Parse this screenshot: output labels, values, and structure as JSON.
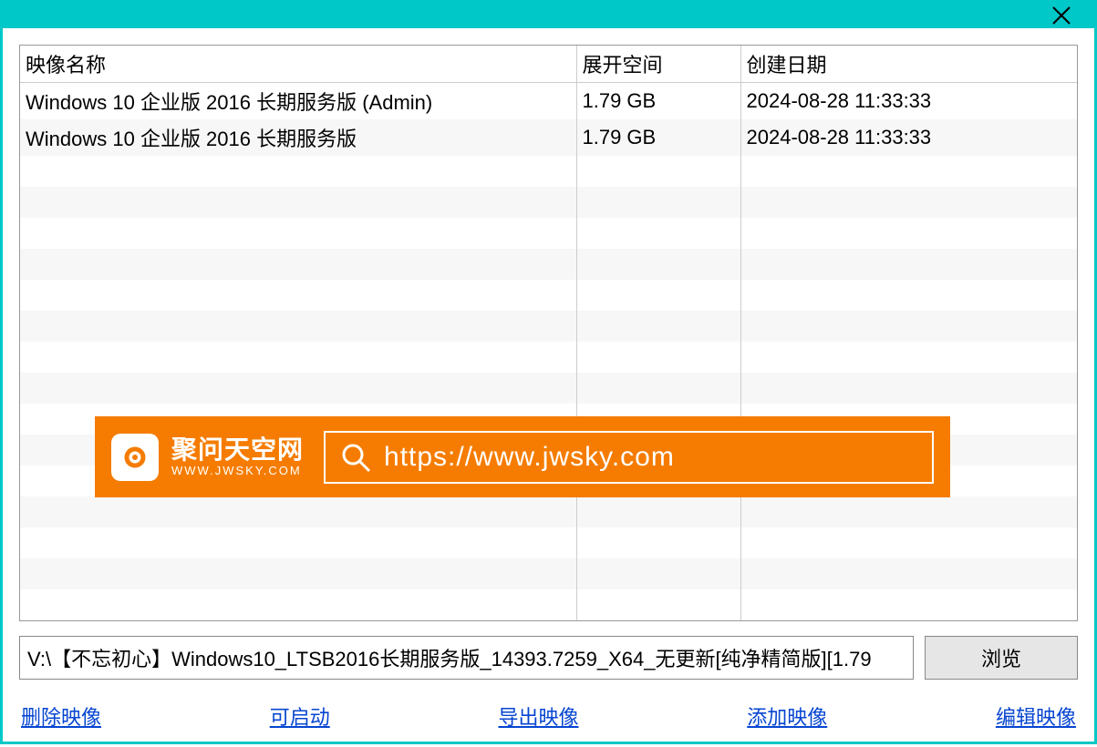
{
  "table": {
    "headers": {
      "name": "映像名称",
      "size": "展开空间",
      "date": "创建日期"
    },
    "rows": [
      {
        "name": "Windows 10 企业版 2016 长期服务版  (Admin)",
        "size": "1.79 GB",
        "date": "2024-08-28 11:33:33"
      },
      {
        "name": "Windows 10 企业版 2016 长期服务版",
        "size": "1.79 GB",
        "date": "2024-08-28 11:33:33"
      }
    ]
  },
  "banner": {
    "site_name": "聚问天空网",
    "site_sub": "WWW.JWSKY.COM",
    "url": "https://www.jwsky.com"
  },
  "path": "V:\\【不忘初心】Windows10_LTSB2016长期服务版_14393.7259_X64_无更新[纯净精简版][1.79",
  "buttons": {
    "browse": "浏览"
  },
  "links": {
    "delete": "删除映像",
    "bootable": "可启动",
    "export": "导出映像",
    "add": "添加映像",
    "edit": "编辑映像"
  }
}
